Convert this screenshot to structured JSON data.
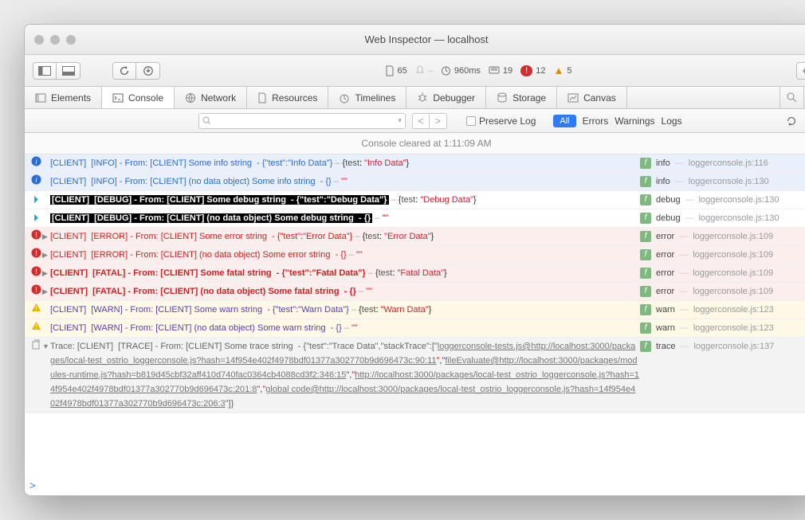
{
  "window": {
    "title": "Web Inspector — localhost"
  },
  "toolbar": {
    "resources_count": "65",
    "time_ms": "960ms",
    "msg_count": "19",
    "error_count": "12",
    "warn_count": "5"
  },
  "tabs": {
    "items": [
      {
        "name": "elements",
        "label": "Elements"
      },
      {
        "name": "console",
        "label": "Console"
      },
      {
        "name": "network",
        "label": "Network"
      },
      {
        "name": "resources",
        "label": "Resources"
      },
      {
        "name": "timelines",
        "label": "Timelines"
      },
      {
        "name": "debugger",
        "label": "Debugger"
      },
      {
        "name": "storage",
        "label": "Storage"
      },
      {
        "name": "canvas",
        "label": "Canvas"
      }
    ],
    "active": "console"
  },
  "filter": {
    "search_placeholder": "",
    "preserve_label": "Preserve Log",
    "options": {
      "all": "All",
      "errors": "Errors",
      "warnings": "Warnings",
      "logs": "Logs"
    }
  },
  "cleared_label": "Console cleared at 1:11:09 AM",
  "src_files": {
    "a": "loggerconsole.js:116",
    "b": "loggerconsole.js:130",
    "c": "loggerconsole.js:109",
    "d": "loggerconsole.js:123",
    "e": "loggerconsole.js:137"
  },
  "logs": [
    {
      "kind": "info",
      "fn": "info",
      "src": "a",
      "text": "[CLIENT]  [INFO] - From: [CLIENT] Some info string  - {\"test\":\"Info Data\"}",
      "obj_key": "test",
      "obj_val": "Info Data"
    },
    {
      "kind": "info",
      "fn": "info",
      "src": "b",
      "text": "[CLIENT]  [INFO] - From: [CLIENT] (no data object) Some info string  - {}",
      "obj_quote": "\"\""
    },
    {
      "kind": "debug",
      "fn": "debug",
      "src": "b",
      "text": "[CLIENT]  [DEBUG] - From: [CLIENT] Some debug string  - {\"test\":\"Debug Data\"}",
      "obj_key": "test",
      "obj_val": "Debug Data"
    },
    {
      "kind": "debug",
      "fn": "debug",
      "src": "b",
      "text": "[CLIENT]  [DEBUG] - From: [CLIENT] (no data object) Some debug string  - {}",
      "obj_quote": "\"\""
    },
    {
      "kind": "error",
      "fn": "error",
      "src": "c",
      "expandable": true,
      "text": "[CLIENT]  [ERROR] - From: [CLIENT] Some error string  - {\"test\":\"Error Data\"}",
      "obj_key": "test",
      "obj_val": "Error Data"
    },
    {
      "kind": "error",
      "fn": "error",
      "src": "c",
      "expandable": true,
      "text": "[CLIENT]  [ERROR] - From: [CLIENT] (no data object) Some error string  - {}",
      "obj_quote": "\"\""
    },
    {
      "kind": "fatal",
      "fn": "error",
      "src": "c",
      "expandable": true,
      "text": "[CLIENT]  [FATAL] - From: [CLIENT] Some fatal string  - {\"test\":\"Fatal Data\"}",
      "obj_key": "test",
      "obj_val": "Fatal Data"
    },
    {
      "kind": "fatal",
      "fn": "error",
      "src": "c",
      "expandable": true,
      "text": "[CLIENT]  [FATAL] - From: [CLIENT] (no data object) Some fatal string  - {}",
      "obj_quote": "\"\""
    },
    {
      "kind": "warn",
      "fn": "warn",
      "src": "d",
      "text": "[CLIENT]  [WARN] - From: [CLIENT] Some warn string  - {\"test\":\"Warn Data\"}",
      "obj_key": "test",
      "obj_val": "Warn Data"
    },
    {
      "kind": "warn",
      "fn": "warn",
      "src": "d",
      "text": "[CLIENT]  [WARN] - From: [CLIENT] (no data object) Some warn string  - {}",
      "obj_quote": "\"\""
    }
  ],
  "trace": {
    "fn": "trace",
    "src": "e",
    "prefix": "Trace: ",
    "head": "[CLIENT]  [TRACE] - From: [CLIENT] Some trace string  - {\"test\":\"Trace Data\",\"stackTrace\":[\"",
    "link1": "loggerconsole-tests.js@http://localhost:3000/packages/local-test_ostrio_loggerconsole.js?hash=14f954e402f4978bdf01377a302770b9d696473c:90:11",
    "mid1": "\",\"",
    "link2": "fileEvaluate@http://localhost:3000/packages/modules-runtime.js?hash=b819d45cbf32aff410d740fac0364cb4088cd3f2:346:15",
    "mid2": "\",\"",
    "link3": "http://localhost:3000/packages/local-test_ostrio_loggerconsole.js?hash=14f954e402f4978bdf01377a302770b9d696473c:201:8",
    "mid3": "\",\"",
    "link4": "global code@http://localhost:3000/packages/local-test_ostrio_loggerconsole.js?hash=14f954e402f4978bdf01377a302770b9d696473c:206:3",
    "tail": "\"]}"
  },
  "prompt_symbol": ">"
}
